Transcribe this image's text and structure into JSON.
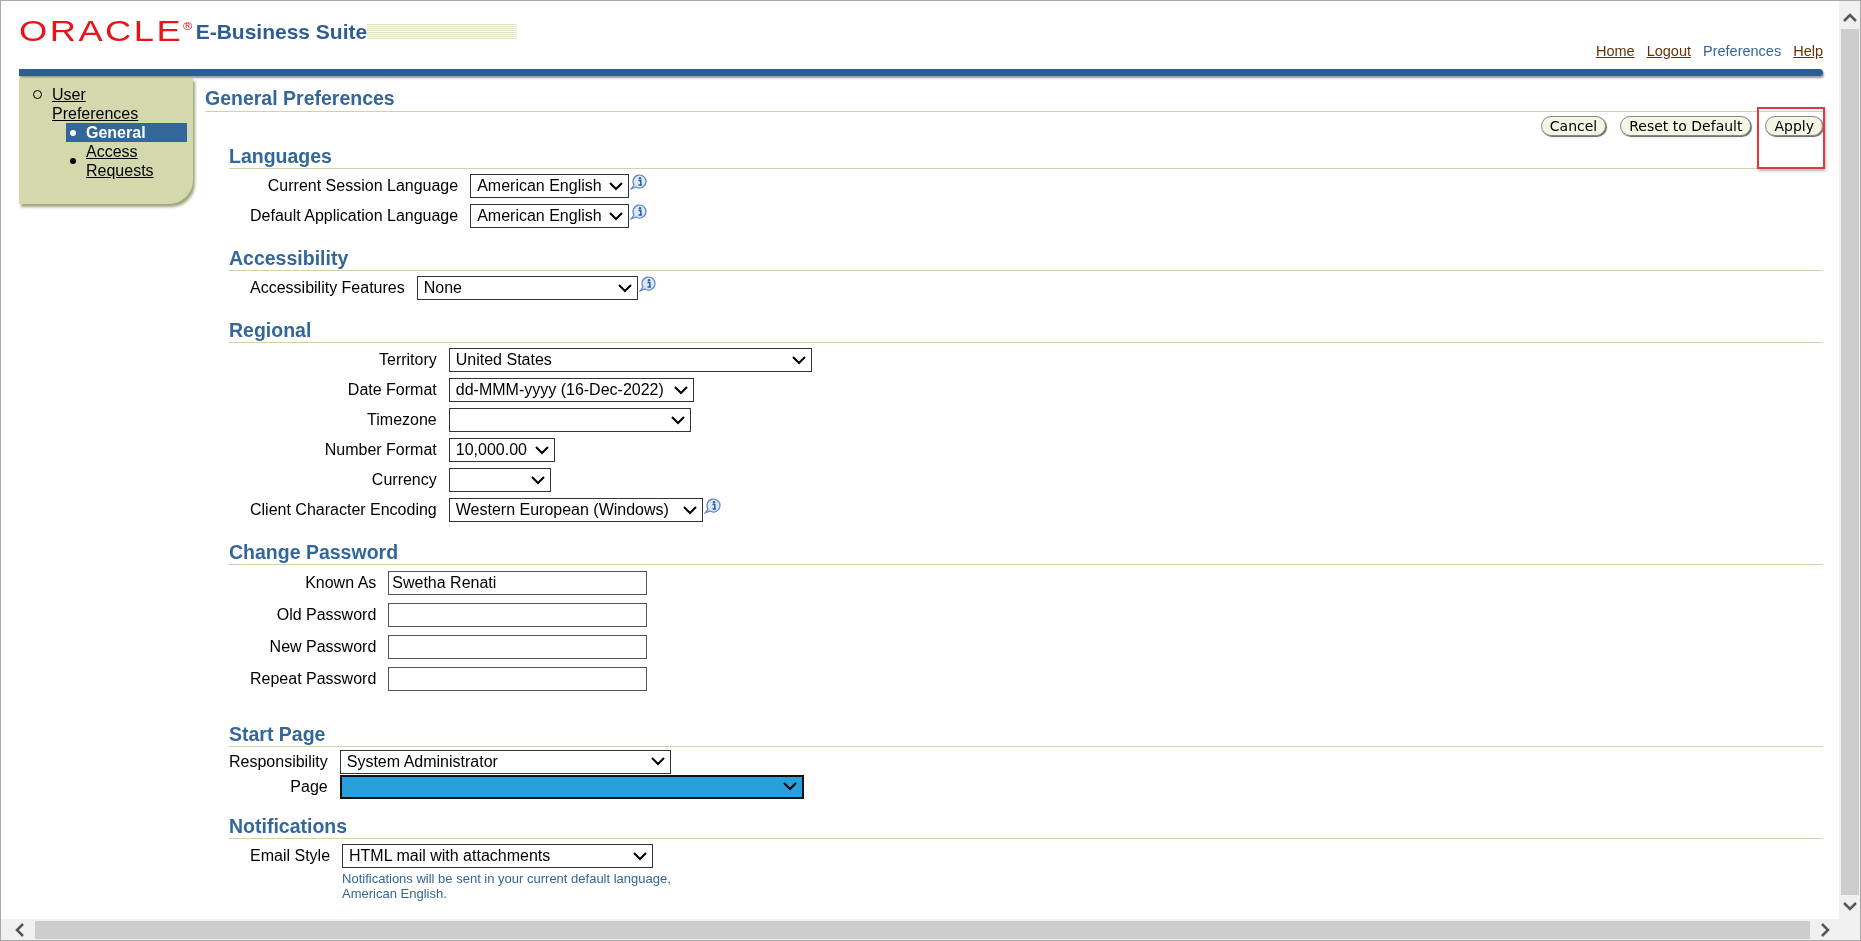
{
  "header": {
    "logo": "ORACLE$^{®}$",
    "product": "E-Business Suite",
    "links": [
      {
        "label": "Home",
        "selected": false
      },
      {
        "label": "Logout",
        "selected": false
      },
      {
        "label": "Preferences",
        "selected": true
      },
      {
        "label": "Help",
        "selected": false
      }
    ]
  },
  "sidebar": {
    "items": [
      {
        "label": "User Preferences",
        "children": [
          {
            "label": "General",
            "selected": true
          },
          {
            "label": "Access Requests",
            "selected": false
          }
        ]
      }
    ]
  },
  "page": {
    "title": "General Preferences",
    "buttons": [
      {
        "label": "Cancel",
        "highlighted": false
      },
      {
        "label": "Reset to Default",
        "highlighted": false
      },
      {
        "label": "Apply",
        "highlighted": true
      }
    ]
  },
  "sections": [
    {
      "title": "Languages",
      "fields": [
        {
          "label": "Current Session Language",
          "kind": "select",
          "value": "American English",
          "info": true
        },
        {
          "label": "Default Application Language",
          "kind": "select",
          "value": "American English",
          "info": true
        }
      ]
    },
    {
      "title": "Accessibility",
      "fields": [
        {
          "label": "Accessibility Features",
          "kind": "select",
          "value": "None",
          "info": true
        }
      ]
    },
    {
      "title": "Regional",
      "fields": [
        {
          "label": "Territory",
          "kind": "select",
          "value": "United States"
        },
        {
          "label": "Date Format",
          "kind": "select",
          "value": "dd-MMM-yyyy (16-Dec-2022)"
        },
        {
          "label": "Timezone",
          "kind": "select"
        },
        {
          "label": "Number Format",
          "kind": "select",
          "value": "10,000.00"
        },
        {
          "label": "Currency",
          "kind": "select"
        },
        {
          "label": "Client Character Encoding",
          "kind": "select",
          "value": "Western European (Windows)",
          "info": true
        }
      ]
    },
    {
      "title": "Change Password",
      "fields": [
        {
          "label": "Known As",
          "kind": "text",
          "value": "Swetha Renati"
        },
        {
          "label": "Old Password",
          "kind": "text"
        },
        {
          "label": "New Password",
          "kind": "text"
        },
        {
          "label": "Repeat Password",
          "kind": "text"
        }
      ]
    },
    {
      "title": "Start Page",
      "fields": [
        {
          "label": "Responsibility",
          "kind": "select",
          "value": "System Administrator"
        },
        {
          "label": "Page",
          "kind": "select",
          "focused": true
        }
      ]
    },
    {
      "title": "Notifications",
      "fields": [
        {
          "label": "Email Style",
          "kind": "select",
          "value": "HTML mail with attachments",
          "note": "Notifications will be sent in your current default language, American English."
        }
      ]
    }
  ]
}
